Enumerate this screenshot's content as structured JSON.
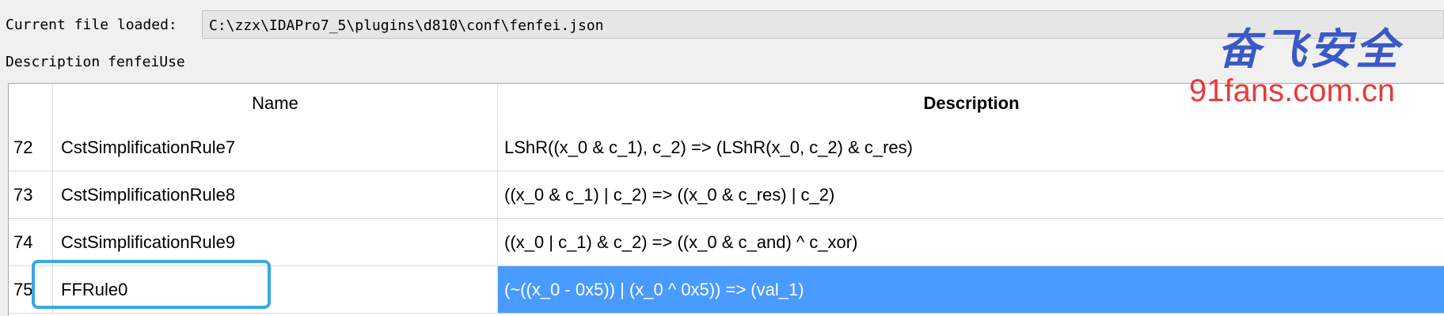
{
  "file": {
    "label": "Current file loaded:",
    "path": "C:\\zzx\\IDAPro7_5\\plugins\\d810\\conf\\fenfei.json"
  },
  "description": {
    "label": "Description",
    "value": "fenfeiUse"
  },
  "table": {
    "columns": [
      "",
      "Name",
      "Description"
    ],
    "rows": [
      {
        "index": "72",
        "name": "CstSimplificationRule7",
        "description": "LShR((x_0 & c_1), c_2) => (LShR(x_0, c_2) & c_res)"
      },
      {
        "index": "73",
        "name": "CstSimplificationRule8",
        "description": "((x_0 & c_1) | c_2) => ((x_0 & c_res) | c_2)"
      },
      {
        "index": "74",
        "name": "CstSimplificationRule9",
        "description": "((x_0 | c_1) & c_2) => ((x_0 & c_and) ^ c_xor)"
      },
      {
        "index": "75",
        "name": "FFRule0",
        "description": "(~((x_0 - 0x5)) | (x_0 ^ 0x5)) => (val_1)"
      }
    ],
    "selected_row": "75"
  },
  "watermark": {
    "chinese": "奋飞安全",
    "url": "91fans.com.cn"
  },
  "colors": {
    "selection": "#4a9bff",
    "highlight_box": "#3aa7e8",
    "watermark_cn": "#3b58c6",
    "watermark_url": "#e83a3a"
  }
}
